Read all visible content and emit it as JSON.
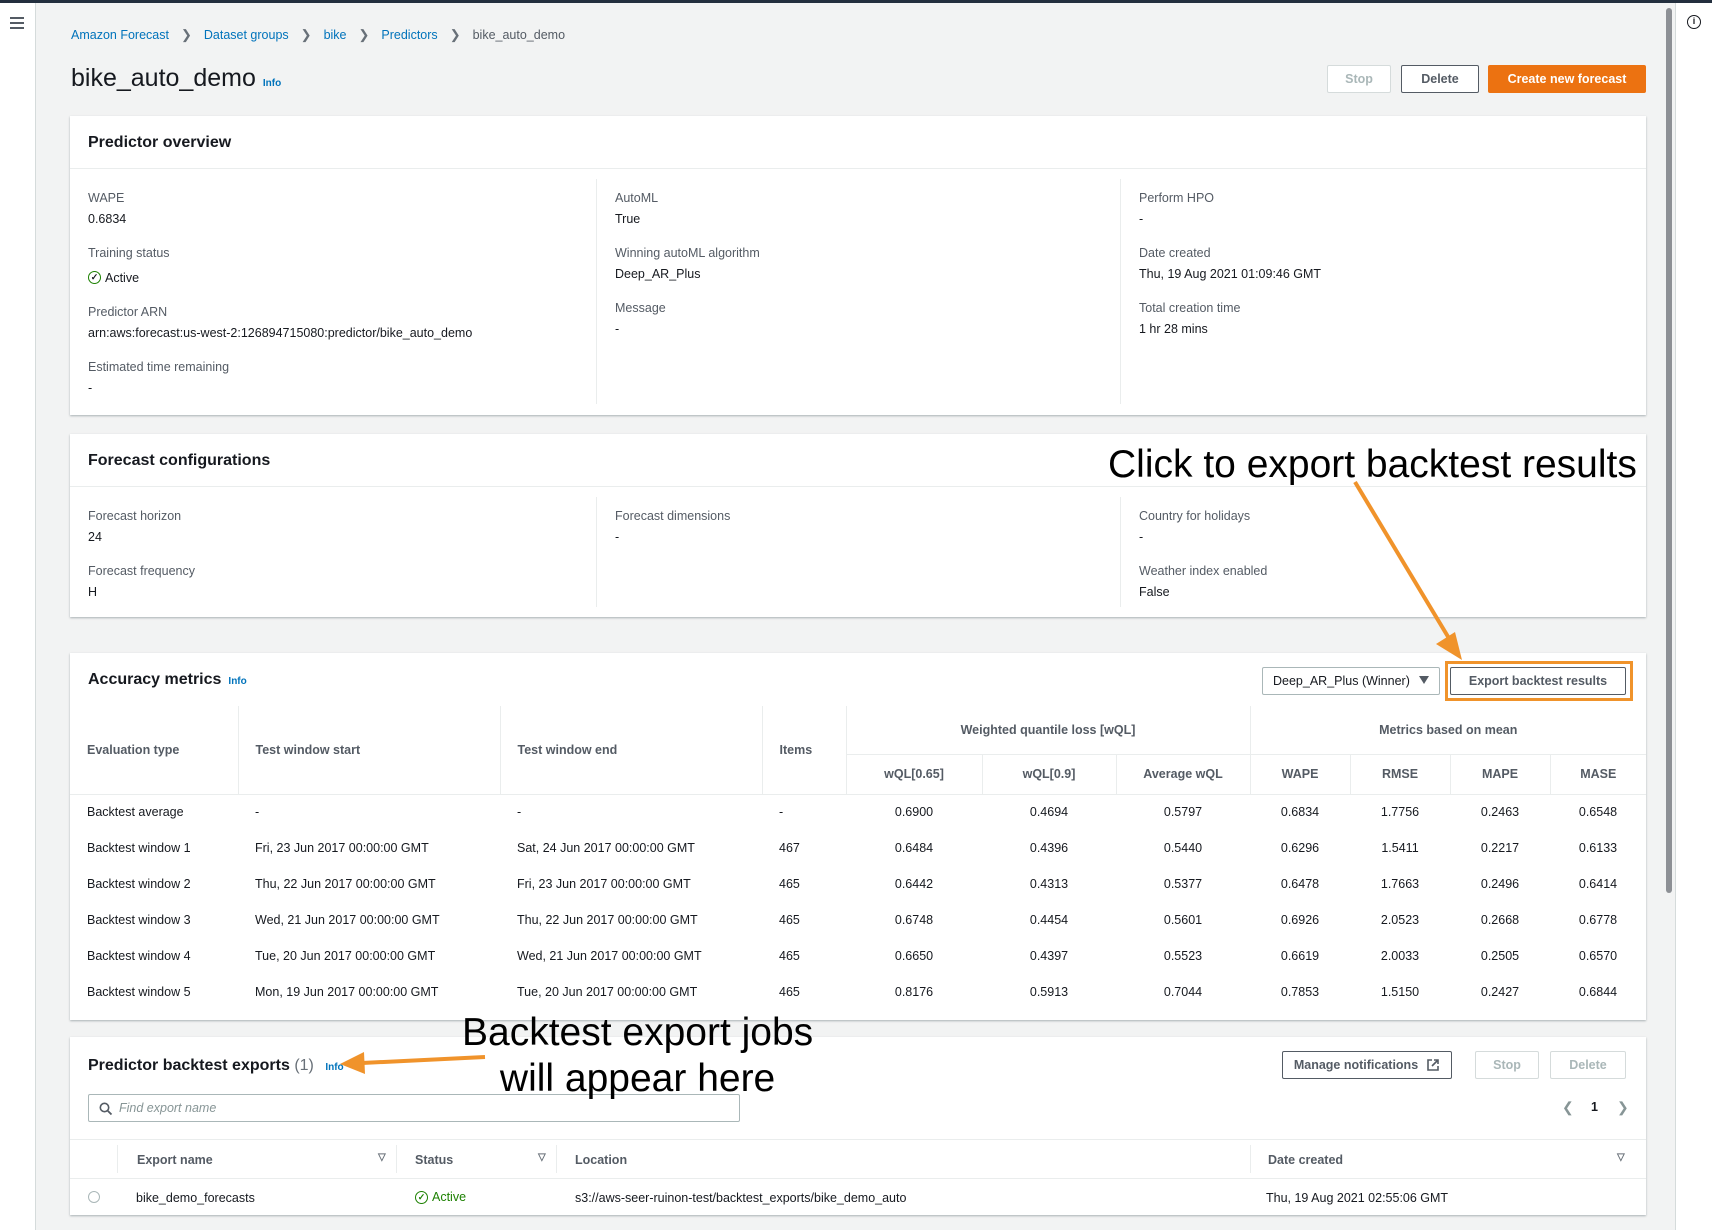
{
  "breadcrumb": {
    "items": [
      "Amazon Forecast",
      "Dataset groups",
      "bike",
      "Predictors"
    ],
    "current": "bike_auto_demo"
  },
  "page": {
    "title": "bike_auto_demo",
    "info": "Info",
    "stop": "Stop",
    "delete": "Delete",
    "create": "Create new forecast"
  },
  "overview": {
    "title": "Predictor overview",
    "wape_label": "WAPE",
    "wape_value": "0.6834",
    "training_status_label": "Training status",
    "training_status_value": "Active",
    "arn_label": "Predictor ARN",
    "arn_value": "arn:aws:forecast:us-west-2:126894715080:predictor/bike_auto_demo",
    "eta_label": "Estimated time remaining",
    "eta_value": "-",
    "automl_label": "AutoML",
    "automl_value": "True",
    "winning_label": "Winning autoML algorithm",
    "winning_value": "Deep_AR_Plus",
    "message_label": "Message",
    "message_value": "-",
    "hpo_label": "Perform HPO",
    "hpo_value": "-",
    "date_label": "Date created",
    "date_value": "Thu, 19 Aug 2021 01:09:46 GMT",
    "total_label": "Total creation time",
    "total_value": "1 hr 28 mins"
  },
  "forecast_config": {
    "title": "Forecast configurations",
    "horizon_label": "Forecast horizon",
    "horizon_value": "24",
    "frequency_label": "Forecast frequency",
    "frequency_value": "H",
    "dimensions_label": "Forecast dimensions",
    "dimensions_value": "-",
    "country_label": "Country for holidays",
    "country_value": "-",
    "weather_label": "Weather index enabled",
    "weather_value": "False"
  },
  "annotations": {
    "export_hint": "Click to export backtest results",
    "jobs_hint_line1": "Backtest export jobs",
    "jobs_hint_line2": "will appear here",
    "arrow_color": "#f0932b"
  },
  "accuracy": {
    "title": "Accuracy metrics",
    "info": "Info",
    "selector": "Deep_AR_Plus (Winner)",
    "export_button": "Export backtest results",
    "headers": {
      "eval_type": "Evaluation type",
      "start": "Test window start",
      "end": "Test window end",
      "items": "Items",
      "wql_group": "Weighted quantile loss [wQL]",
      "mean_group": "Metrics based on mean",
      "wql065": "wQL[0.65]",
      "wql09": "wQL[0.9]",
      "avg_wql": "Average wQL",
      "wape": "WAPE",
      "rmse": "RMSE",
      "mape": "MAPE",
      "mase": "MASE"
    },
    "rows": [
      [
        "Backtest average",
        "-",
        "-",
        "-",
        "0.6900",
        "0.4694",
        "0.5797",
        "0.6834",
        "1.7756",
        "0.2463",
        "0.6548"
      ],
      [
        "Backtest window 1",
        "Fri, 23 Jun 2017 00:00:00 GMT",
        "Sat, 24 Jun 2017 00:00:00 GMT",
        "467",
        "0.6484",
        "0.4396",
        "0.5440",
        "0.6296",
        "1.5411",
        "0.2217",
        "0.6133"
      ],
      [
        "Backtest window 2",
        "Thu, 22 Jun 2017 00:00:00 GMT",
        "Fri, 23 Jun 2017 00:00:00 GMT",
        "465",
        "0.6442",
        "0.4313",
        "0.5377",
        "0.6478",
        "1.7663",
        "0.2496",
        "0.6414"
      ],
      [
        "Backtest window 3",
        "Wed, 21 Jun 2017 00:00:00 GMT",
        "Thu, 22 Jun 2017 00:00:00 GMT",
        "465",
        "0.6748",
        "0.4454",
        "0.5601",
        "0.6926",
        "2.0523",
        "0.2668",
        "0.6778"
      ],
      [
        "Backtest window 4",
        "Tue, 20 Jun 2017 00:00:00 GMT",
        "Wed, 21 Jun 2017 00:00:00 GMT",
        "465",
        "0.6650",
        "0.4397",
        "0.5523",
        "0.6619",
        "2.0033",
        "0.2505",
        "0.6570"
      ],
      [
        "Backtest window 5",
        "Mon, 19 Jun 2017 00:00:00 GMT",
        "Tue, 20 Jun 2017 00:00:00 GMT",
        "465",
        "0.8176",
        "0.5913",
        "0.7044",
        "0.7853",
        "1.5150",
        "0.2427",
        "0.6844"
      ]
    ]
  },
  "exports": {
    "title": "Predictor backtest exports",
    "count": "(1)",
    "info": "Info",
    "manage": "Manage notifications",
    "stop": "Stop",
    "delete": "Delete",
    "search_placeholder": "Find export name",
    "page": "1",
    "headers": {
      "name": "Export name",
      "status": "Status",
      "location": "Location",
      "date": "Date created"
    },
    "rows": [
      {
        "name": "bike_demo_forecasts",
        "status": "Active",
        "location": "s3://aws-seer-ruinon-test/backtest_exports/bike_demo_auto",
        "date": "Thu, 19 Aug 2021 02:55:06 GMT"
      }
    ]
  }
}
